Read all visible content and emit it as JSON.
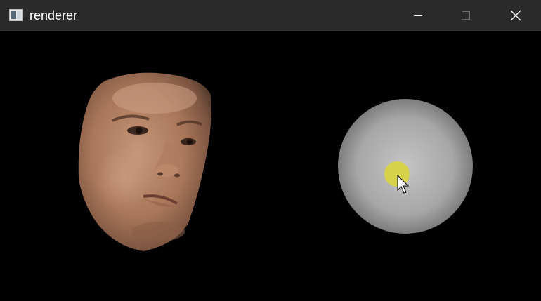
{
  "window": {
    "title": "renderer",
    "icon": "app-window-icon",
    "controls": [
      "minimize-icon",
      "maximize-icon",
      "close-icon"
    ]
  },
  "viewport": {
    "background": "#000000",
    "objects": [
      "face-mesh",
      "light-sphere",
      "light-source-marker"
    ],
    "light_marker_color": "#d6d34a",
    "sphere_color": "#9a9a9a"
  },
  "cursor": {
    "icon": "mouse-pointer-icon"
  }
}
